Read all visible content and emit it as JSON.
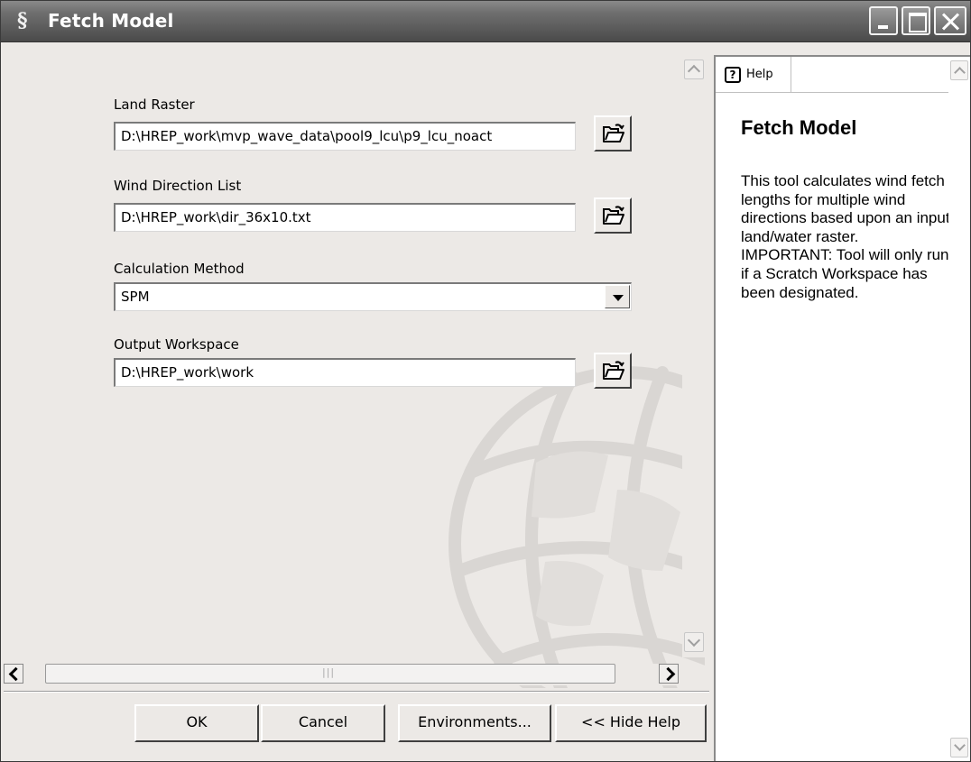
{
  "window": {
    "title": "Fetch Model",
    "app_icon": "arcgis-tool-icon"
  },
  "parameters": [
    {
      "label": "Land Raster",
      "value": "D:\\HREP_work\\mvp_wave_data\\pool9_lcu\\p9_lcu_noact",
      "control": "text-with-browse"
    },
    {
      "label": "Wind Direction List",
      "value": "D:\\HREP_work\\dir_36x10.txt",
      "control": "text-with-browse"
    },
    {
      "label": "Calculation Method",
      "value": "SPM",
      "control": "dropdown"
    },
    {
      "label": "Output Workspace",
      "value": "D:\\HREP_work\\work",
      "control": "text-with-browse"
    }
  ],
  "buttons": {
    "ok": "OK",
    "cancel": "Cancel",
    "environments": "Environments...",
    "hide_help": "<< Hide Help"
  },
  "help": {
    "tab_label": "Help",
    "title": "Fetch Model",
    "body": "This tool calculates wind fetch lengths for multiple wind directions based upon an input land/water raster. IMPORTANT: Tool will only run if a Scratch Workspace has been designated."
  }
}
